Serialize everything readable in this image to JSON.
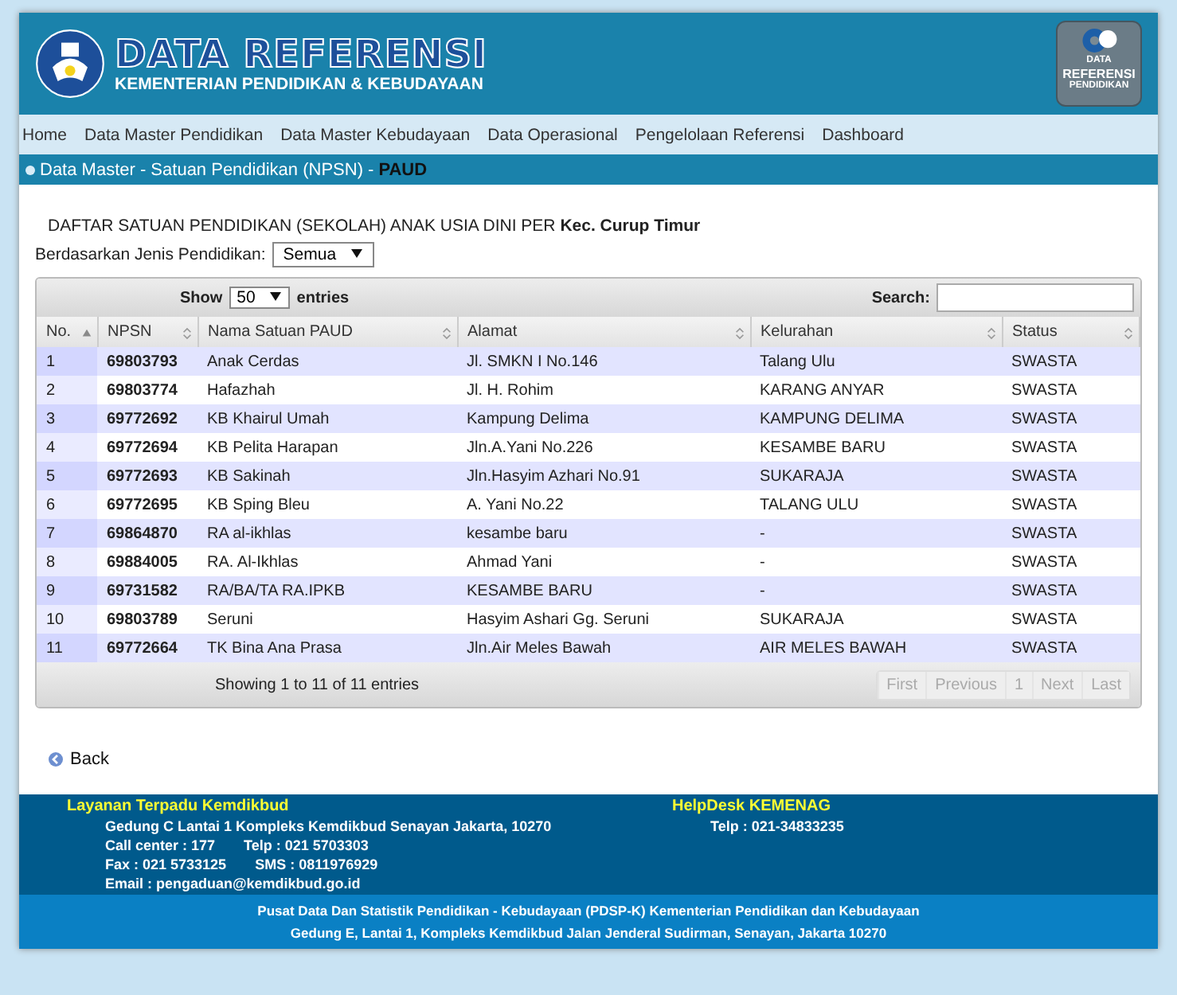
{
  "header": {
    "title": "DATA REFERENSI",
    "subtitle": "KEMENTERIAN PENDIDIKAN & KEBUDAYAAN",
    "badge_lines": [
      "DATA",
      "REFERENSI",
      "PENDIDIKAN"
    ]
  },
  "nav": [
    "Home",
    "Data Master Pendidikan",
    "Data Master Kebudayaan",
    "Data Operasional",
    "Pengelolaan Referensi",
    "Dashboard"
  ],
  "breadcrumb": {
    "path": "Data Master - Satuan Pendidikan (NPSN) -",
    "current": "PAUD"
  },
  "heading": "DAFTAR SATUAN PENDIDIKAN (SEKOLAH) ANAK USIA DINI PER **Kec. Curup Timur**",
  "filter": {
    "label": "Berdasarkan Jenis Pendidikan:",
    "value": "Semua"
  },
  "length": {
    "before": "Show",
    "value": "50",
    "after": "entries"
  },
  "search": {
    "label": "Search:"
  },
  "table": {
    "columns": [
      {
        "label": "No.",
        "sorted": true
      },
      {
        "label": "NPSN",
        "sorted": false
      },
      {
        "label": "Nama Satuan PAUD",
        "sorted": false
      },
      {
        "label": "Alamat",
        "sorted": false
      },
      {
        "label": "Kelurahan",
        "sorted": false
      },
      {
        "label": "Status",
        "sorted": false
      }
    ],
    "rows": [
      [
        "1",
        "69803793",
        "Anak Cerdas",
        "Jl. SMKN I No.146",
        "Talang Ulu",
        "SWASTA"
      ],
      [
        "2",
        "69803774",
        "Hafazhah",
        "Jl. H. Rohim",
        "KARANG ANYAR",
        "SWASTA"
      ],
      [
        "3",
        "69772692",
        "KB Khairul Umah",
        "Kampung Delima",
        "KAMPUNG DELIMA",
        "SWASTA"
      ],
      [
        "4",
        "69772694",
        "KB Pelita Harapan",
        "Jln.A.Yani No.226",
        "KESAMBE BARU",
        "SWASTA"
      ],
      [
        "5",
        "69772693",
        "KB Sakinah",
        "Jln.Hasyim Azhari No.91",
        "SUKARAJA",
        "SWASTA"
      ],
      [
        "6",
        "69772695",
        "KB Sping Bleu",
        "A. Yani No.22",
        "TALANG ULU",
        "SWASTA"
      ],
      [
        "7",
        "69864870",
        "RA al-ikhlas",
        "kesambe baru",
        "-",
        "SWASTA"
      ],
      [
        "8",
        "69884005",
        "RA. Al-Ikhlas",
        "Ahmad Yani",
        "-",
        "SWASTA"
      ],
      [
        "9",
        "69731582",
        "RA/BA/TA RA.IPKB",
        "KESAMBE BARU",
        "-",
        "SWASTA"
      ],
      [
        "10",
        "69803789",
        "Seruni",
        "Hasyim Ashari Gg. Seruni",
        "SUKARAJA",
        "SWASTA"
      ],
      [
        "11",
        "69772664",
        "TK Bina Ana Prasa",
        "Jln.Air Meles Bawah",
        "AIR MELES BAWAH",
        "SWASTA"
      ]
    ]
  },
  "info": "Showing 1 to 11 of 11 entries",
  "pager": [
    {
      "label": "First",
      "disabled": true
    },
    {
      "label": "Previous",
      "disabled": true
    },
    {
      "label": "1",
      "disabled": true
    },
    {
      "label": "Next",
      "disabled": true
    },
    {
      "label": "Last",
      "disabled": true
    }
  ],
  "back": "Back",
  "footer": {
    "left_title": "Layanan Terpadu Kemdikbud",
    "left_lines": [
      [
        "Gedung C Lantai 1 Kompleks Kemdikbud Senayan Jakarta, 10270"
      ],
      [
        "Call center : 177",
        "Telp : 021 5703303"
      ],
      [
        "Fax : 021 5733125",
        "SMS : 0811976929"
      ],
      [
        "Email : pengaduan@kemdikbud.go.id"
      ]
    ],
    "right_title": "HelpDesk KEMENAG",
    "right_lines": [
      [
        "Telp : 021-34833235"
      ]
    ],
    "bottom": [
      "Pusat Data Dan Statistik Pendidikan - Kebudayaan (PDSP-K) Kementerian Pendidikan dan Kebudayaan",
      "Gedung E, Lantai 1, Kompleks Kemdikbud Jalan Jenderal Sudirman, Senayan, Jakarta 10270"
    ]
  }
}
